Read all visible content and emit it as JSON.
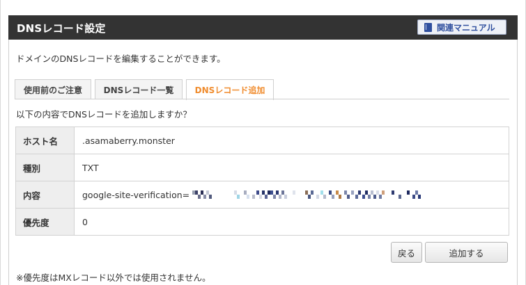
{
  "header": {
    "title": "DNSレコード設定",
    "manual_label": "関連マニュアル"
  },
  "description": "ドメインのDNSレコードを編集することができます。",
  "tabs": [
    {
      "label": "使用前のご注意",
      "active": false
    },
    {
      "label": "DNSレコード一覧",
      "active": false
    },
    {
      "label": "DNSレコード追加",
      "active": true
    }
  ],
  "confirm_text": "以下の内容でDNSレコードを追加しますか？",
  "record": {
    "rows": [
      {
        "label": "ホスト名",
        "value": ".asamaberry.monster"
      },
      {
        "label": "種別",
        "value": "TXT"
      },
      {
        "label": "内容",
        "value": "google-site-verification="
      },
      {
        "label": "優先度",
        "value": "0"
      }
    ]
  },
  "buttons": {
    "back": "戻る",
    "add": "追加する"
  },
  "note": "※優先度はMXレコード以外では使用されません。",
  "colors": {
    "header_bg": "#333333",
    "active_tab": "#f08c2e",
    "manual_text": "#2f4f9e"
  }
}
